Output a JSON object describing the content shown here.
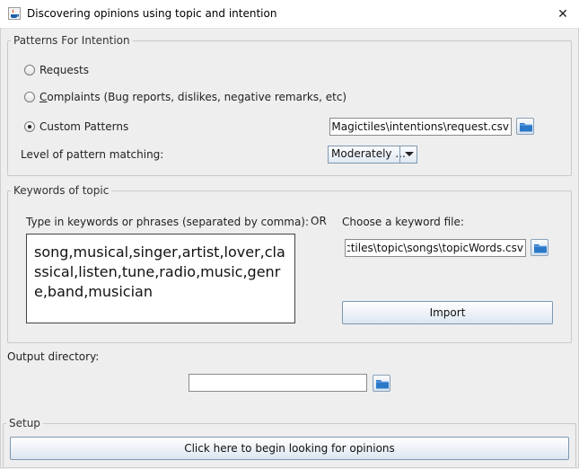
{
  "window": {
    "title": "Discovering opinions using topic and intention",
    "close_glyph": "✕"
  },
  "intention": {
    "group_label": "Patterns For Intention",
    "requests_label": "Requests",
    "complaints_label": "Complaints (Bug reports, dislikes, negative remarks, etc)",
    "custom_label": "Custom Patterns",
    "selected": "custom",
    "custom_path": "nts\\Magictiles\\intentions\\request.csv",
    "matching_label": "Level of pattern matching:",
    "matching_value": "Moderately ..."
  },
  "keywords": {
    "group_label": "Keywords of topic",
    "type_in_label": "Type in keywords or phrases (separated by comma):",
    "or_label": "OR",
    "choose_label": "Choose a keyword file:",
    "text": "song,musical,singer,artist,lover,classical,listen,tune,radio,music,genre,band,musician",
    "file_path": "agictiles\\topic\\songs\\topicWords.csv",
    "import_label": "Import"
  },
  "output": {
    "label": "Output directory:",
    "value": ""
  },
  "setup": {
    "label": "Setup",
    "begin_label": "Click here to begin looking for opinions"
  },
  "colors": {
    "folder_icon": "#2a79c9",
    "window_bg": "#eeeeee"
  }
}
